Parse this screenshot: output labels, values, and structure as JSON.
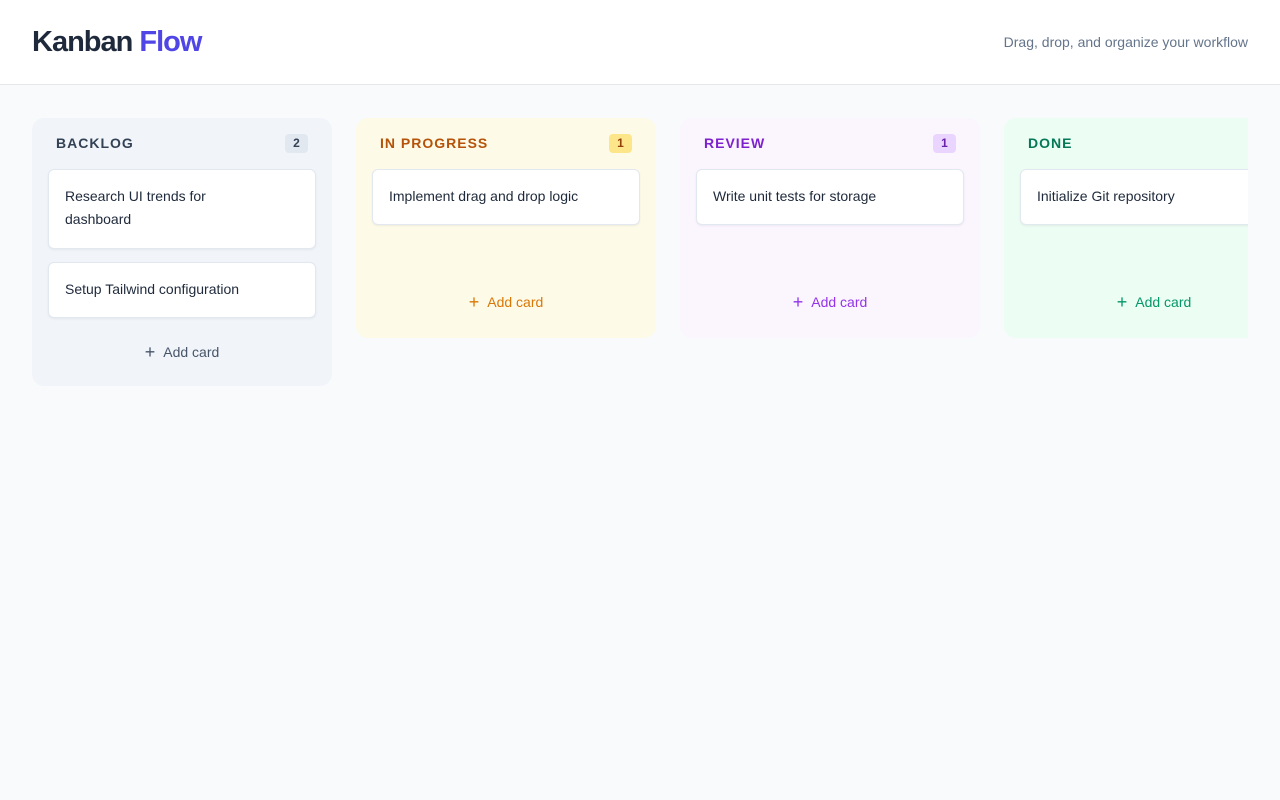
{
  "header": {
    "logo_main": "Kanban",
    "logo_accent": "Flow",
    "tagline": "Drag, drop, and organize your workflow"
  },
  "columns": [
    {
      "title": "BACKLOG",
      "count": "2",
      "cards": [
        "Research UI trends for dashboard",
        "Setup Tailwind configuration"
      ],
      "add_label": "Add card"
    },
    {
      "title": "IN PROGRESS",
      "count": "1",
      "cards": [
        "Implement drag and drop logic"
      ],
      "add_label": "Add card"
    },
    {
      "title": "REVIEW",
      "count": "1",
      "cards": [
        "Write unit tests for storage"
      ],
      "add_label": "Add card"
    },
    {
      "title": "DONE",
      "cards": [
        "Initialize Git repository"
      ],
      "add_label": "Add card"
    }
  ],
  "icons": {
    "add": "plus-icon"
  },
  "colors": {
    "accent": "#4f46e5",
    "backlog": "#334155",
    "in_progress": "#b45309",
    "review": "#7e22ce",
    "done": "#047857"
  }
}
